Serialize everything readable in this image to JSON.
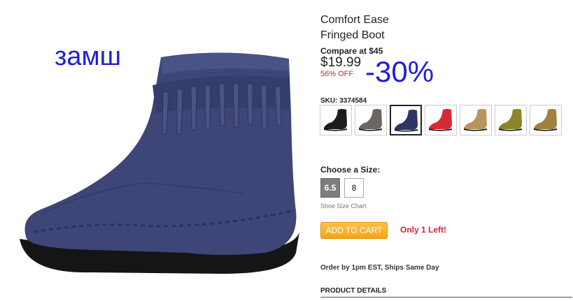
{
  "overlay": {
    "material_note": "замш",
    "promo_note": "-30%"
  },
  "product": {
    "title_line1": "Comfort Ease",
    "title_line2": "Fringed Boot",
    "compare_at": "Compare at $45",
    "price": "$19.99",
    "discount": "56% OFF",
    "sku": "SKU: 3374584"
  },
  "swatches": [
    {
      "color": "#1c1c1c",
      "selected": false
    },
    {
      "color": "#6b6660",
      "selected": false
    },
    {
      "color": "#2c3566",
      "selected": true
    },
    {
      "color": "#d92a33",
      "selected": false
    },
    {
      "color": "#b9955e",
      "selected": false
    },
    {
      "color": "#8c8428",
      "selected": false
    },
    {
      "color": "#a2823a",
      "selected": false
    }
  ],
  "sizes": {
    "label": "Choose a Size:",
    "options": [
      "6.5",
      "8"
    ],
    "selected": "6.5",
    "chart_link": "Shoe Size Chart"
  },
  "cart": {
    "button_label": "ADD TO CART",
    "stock_note": "Only 1 Left!"
  },
  "shipping": "Order by 1pm EST, Ships Same Day",
  "details_heading": "PRODUCT DETAILS",
  "colors": {
    "accent_blue": "#1f1fd6",
    "sale_red": "#d0243c",
    "cart_orange": "#f5a412",
    "boot_navy": "#3e4677"
  }
}
